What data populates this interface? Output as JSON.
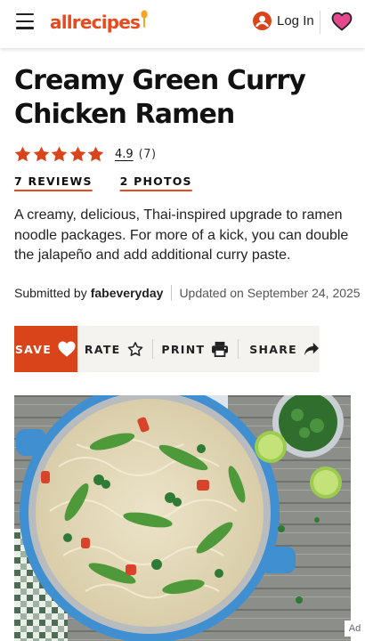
{
  "header": {
    "logo_text": "allrecipes",
    "login_label": "Log In",
    "brand_color": "#e8491d"
  },
  "recipe": {
    "title": "Creamy Green Curry Chicken Ramen",
    "rating": {
      "value": "4.9",
      "count": "(7)",
      "stars": 5
    },
    "reviews_link": "7 REVIEWS",
    "photos_link": "2 PHOTOS",
    "description": "A creamy, delicious, Thai-inspired upgrade to ramen noodle packages. For more of a kick, you can double the jalapeño and add additional curry paste.",
    "submitted_prefix": "Submitted by",
    "author": "fabeveryday",
    "updated": "Updated on September 24, 2025"
  },
  "actions": {
    "save": "SAVE",
    "rate": "RATE",
    "print": "PRINT",
    "share": "SHARE"
  },
  "ad": {
    "label": "Ad"
  },
  "icons": [
    "menu-icon",
    "spoon-icon",
    "user-icon",
    "heart-icon",
    "star-icon",
    "printer-icon",
    "share-arrow-icon"
  ],
  "colors": {
    "accent": "#e8491d",
    "star": "#d9441b",
    "save_bg": "#d9441b",
    "heart_fill": "#e64a8e",
    "action_bar_bg": "#f5f3ef"
  }
}
